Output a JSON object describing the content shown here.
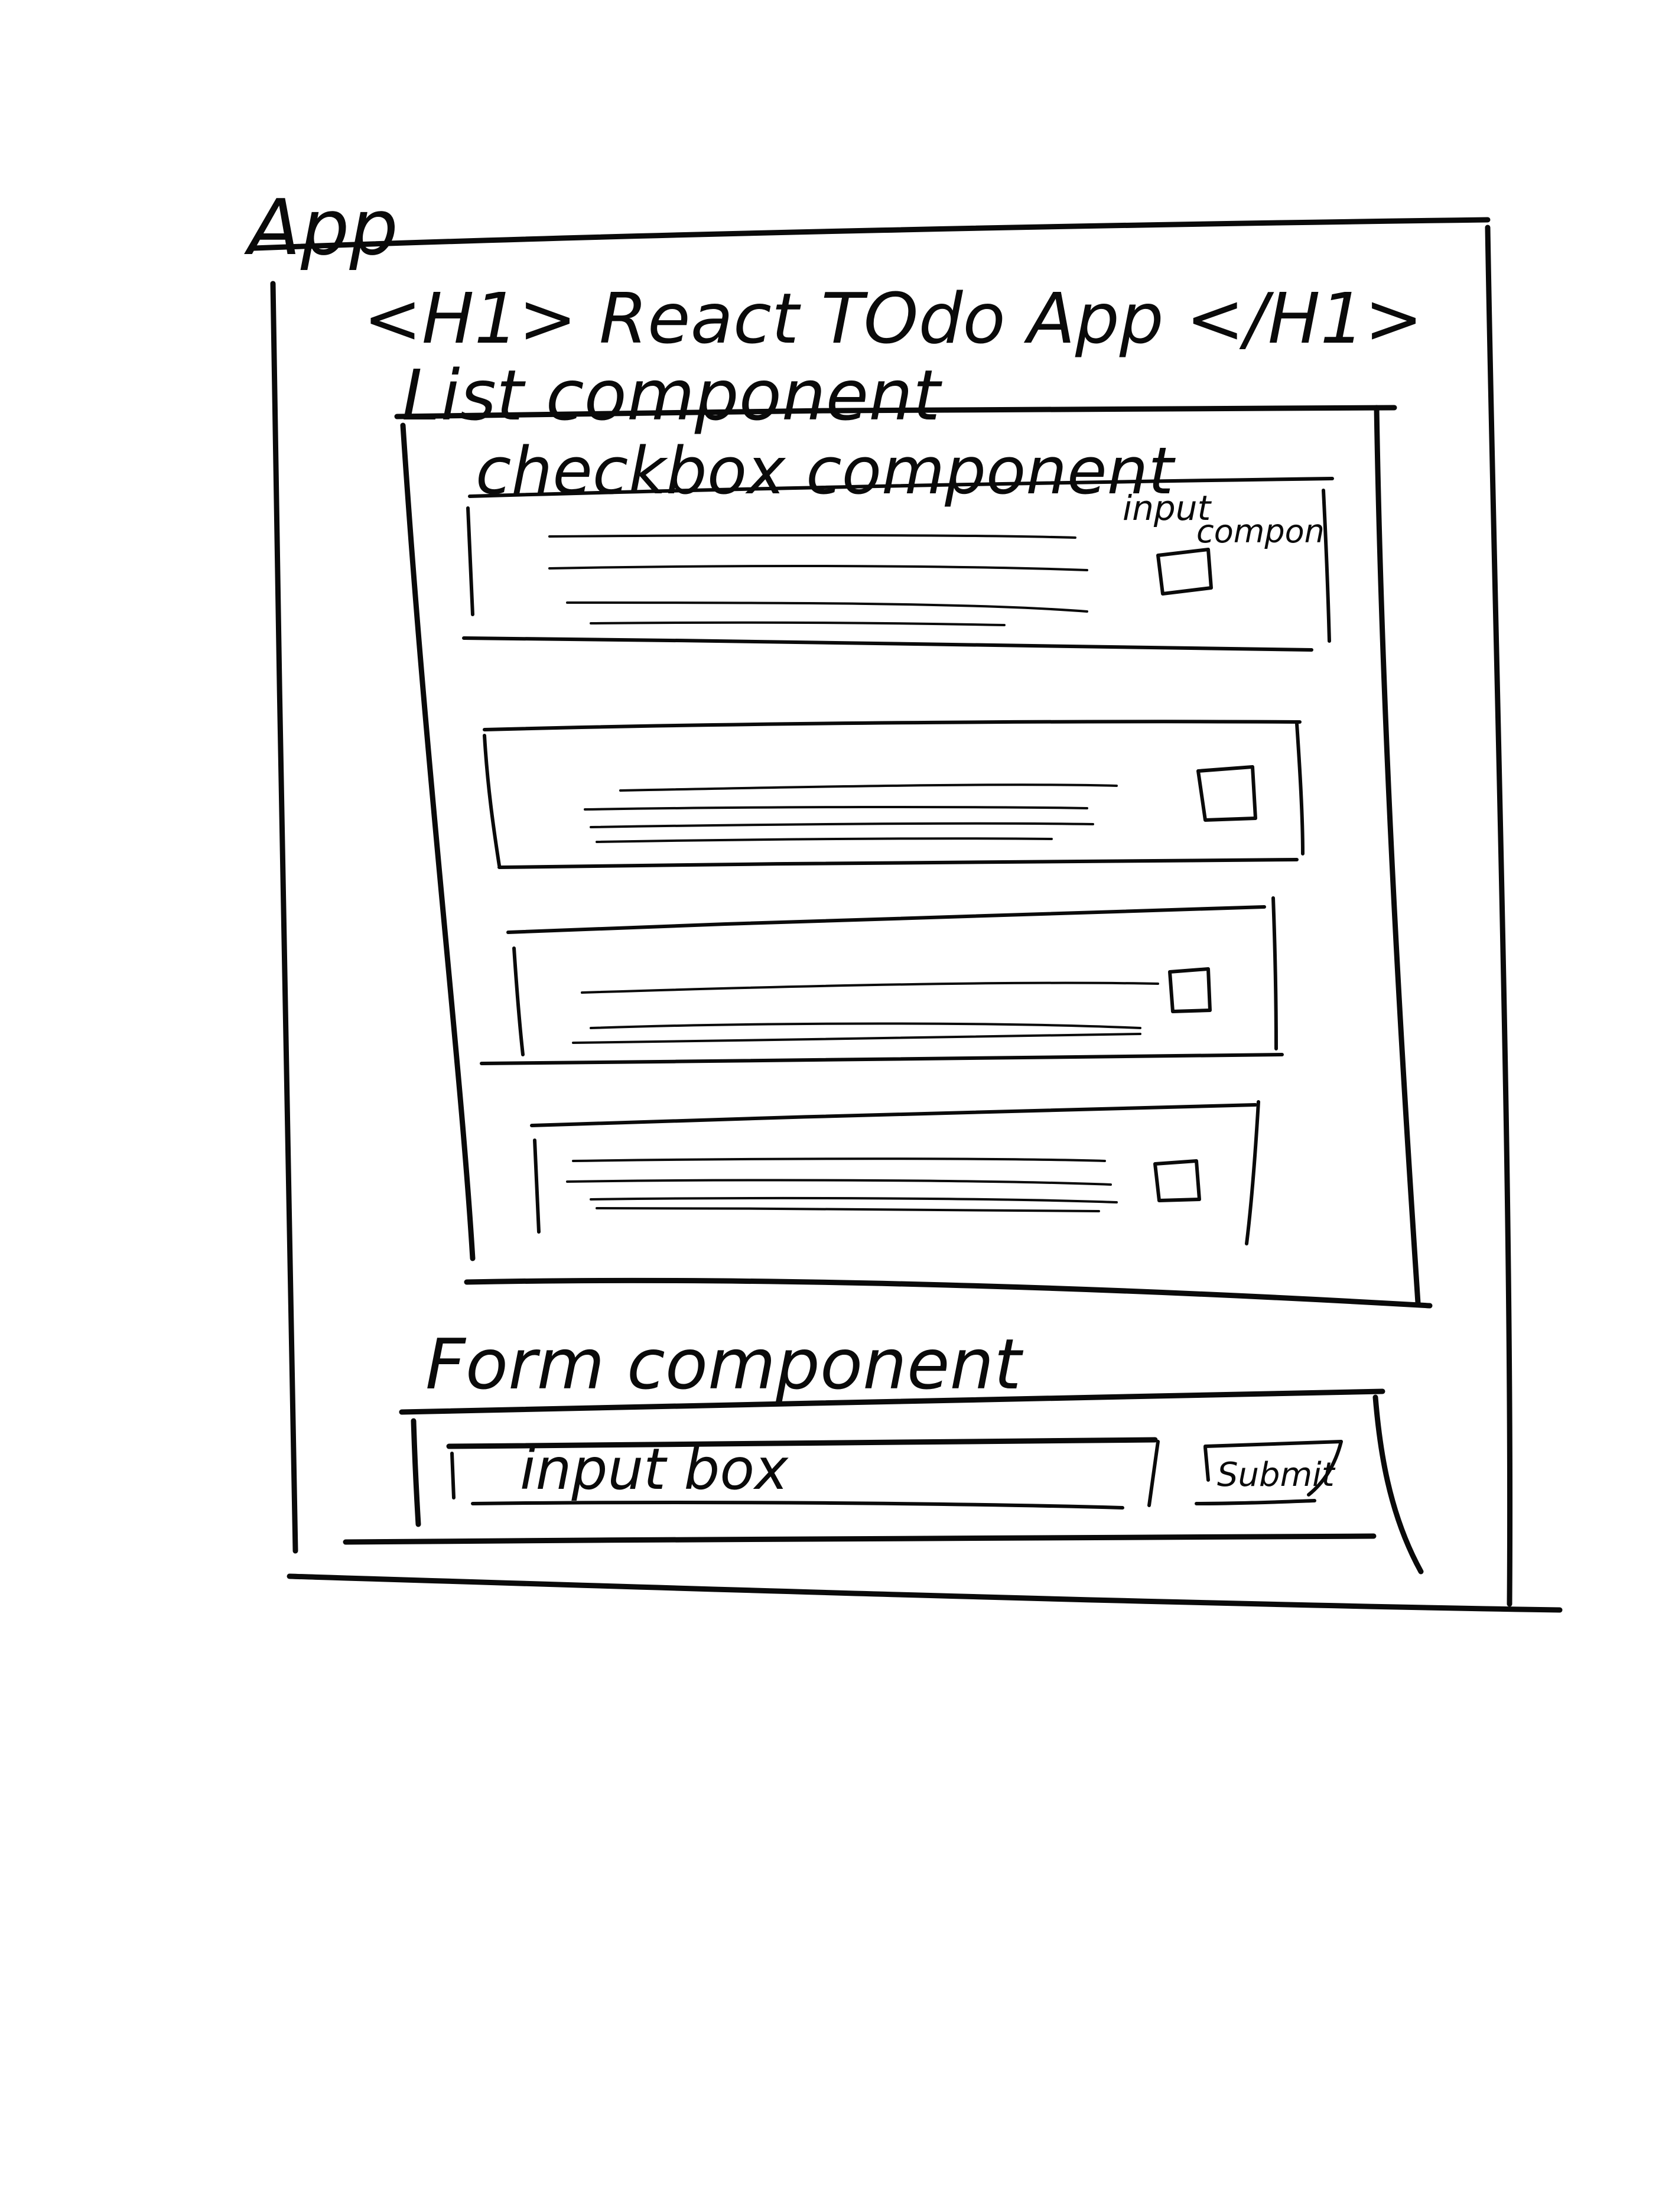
{
  "app_label": "App",
  "header_text": "<H1> React TOdo App </H1>",
  "list_label": "List component",
  "checkbox_label": "checkbox component",
  "input_label_line1": "input",
  "input_label_line2": "compon",
  "form_label": "Form component",
  "input_box_label": "input box",
  "submit_label": "Submit"
}
